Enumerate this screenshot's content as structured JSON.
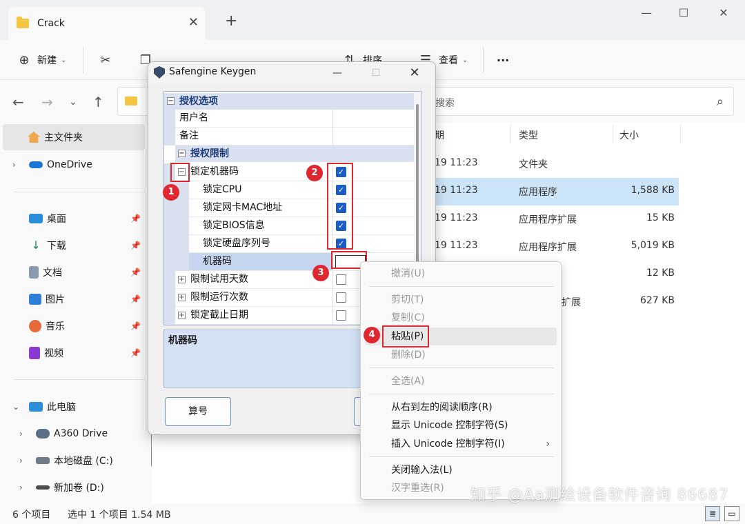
{
  "explorer": {
    "tab_title": "Crack",
    "tab_close": "✕",
    "tab_add": "+",
    "window_controls": {
      "minimize": "—",
      "maximize": "☐",
      "close": "✕"
    },
    "toolbar": {
      "new_label": "新建",
      "sort_label": "排序",
      "view_label": "查看",
      "more_label": "···"
    },
    "search_placeholder": "搜索",
    "nav": {
      "quick_access": "主文件夹",
      "onedrive": "OneDrive",
      "desktop": "桌面",
      "downloads": "下载",
      "documents": "文档",
      "pictures": "图片",
      "music": "音乐",
      "videos": "视频",
      "this_pc": "此电脑",
      "a360": "A360 Drive",
      "disk_c": "本地磁盘 (C:)",
      "disk_d": "新加卷 (D:)"
    },
    "columns": {
      "date_partial": "期",
      "type": "类型",
      "size": "大小"
    },
    "rows": [
      {
        "date": "19 11:23",
        "type": "文件夹",
        "size": ""
      },
      {
        "date": "19 11:23",
        "type": "应用程序",
        "size": "1,588 KB"
      },
      {
        "date": "19 11:23",
        "type": "应用程序扩展",
        "size": "15 KB"
      },
      {
        "date": "19 11:23",
        "type": "应用程序扩展",
        "size": "5,019 KB"
      },
      {
        "date": "",
        "type": "",
        "size": "12 KB"
      },
      {
        "date": "",
        "type": "扩展",
        "size": "627 KB"
      }
    ],
    "status": {
      "count": "6 个项目",
      "selected": "选中 1 个项目  1.54 MB"
    }
  },
  "keygen": {
    "title": "Safengine Keygen",
    "controls": {
      "minimize": "—",
      "maximize": "☐",
      "close": "✕"
    },
    "categories": {
      "license_options": "授权选项",
      "license_limits": "授权限制"
    },
    "props": {
      "username": "用户名",
      "remark": "备注",
      "lock_machine": "锁定机器码",
      "lock_cpu": "锁定CPU",
      "lock_mac": "锁定网卡MAC地址",
      "lock_bios": "锁定BIOS信息",
      "lock_disk": "锁定硬盘序列号",
      "machine_code": "机器码",
      "limit_days": "限制试用天数",
      "limit_runs": "限制运行次数",
      "lock_expiry": "锁定截止日期"
    },
    "expander_minus": "−",
    "expander_plus": "+",
    "check_mark": "✓",
    "description_title": "机器码",
    "calc_button": "算号"
  },
  "annotations": {
    "b1": "1",
    "b2": "2",
    "b3": "3",
    "b4": "4"
  },
  "context_menu": {
    "undo": "撤消(U)",
    "cut": "剪切(T)",
    "copy": "复制(C)",
    "paste": "粘贴(P)",
    "delete": "删除(D)",
    "select_all": "全选(A)",
    "rtl": "从右到左的阅读顺序(R)",
    "show_unicode": "显示 Unicode 控制字符(S)",
    "insert_unicode": "插入 Unicode 控制字符(I)",
    "submenu_arrow": "›",
    "close_ime": "关闭输入法(L)",
    "reconvert": "汉字重选(R)"
  },
  "watermark": "知乎 @Aa测绘设备软件咨询 86687"
}
